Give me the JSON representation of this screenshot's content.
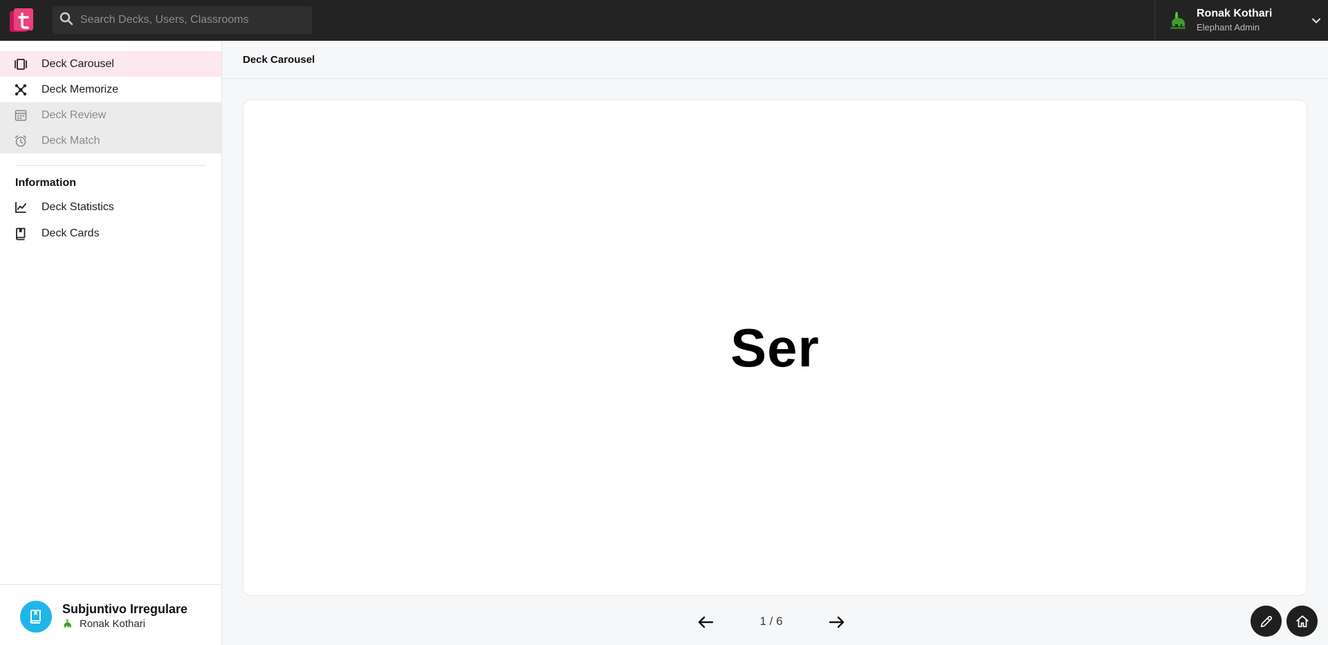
{
  "topbar": {
    "search_placeholder": "Search Decks, Users, Classrooms",
    "user": {
      "name": "Ronak Kothari",
      "role": "Elephant Admin"
    }
  },
  "sidebar": {
    "items": [
      {
        "label": "Deck Carousel",
        "icon": "carousel-icon",
        "state": "active"
      },
      {
        "label": "Deck Memorize",
        "icon": "memorize-icon",
        "state": "normal"
      },
      {
        "label": "Deck Review",
        "icon": "calendar-icon",
        "state": "disabled"
      },
      {
        "label": "Deck Match",
        "icon": "alarm-clock-icon",
        "state": "disabled"
      }
    ],
    "section_title": "Information",
    "info_items": [
      {
        "label": "Deck Statistics",
        "icon": "chart-line-icon"
      },
      {
        "label": "Deck Cards",
        "icon": "book-icon"
      }
    ],
    "deck": {
      "title": "Subjuntivo Irregulare",
      "owner": "Ronak Kothari"
    }
  },
  "main": {
    "header_title": "Deck Carousel",
    "card_text": "Ser",
    "pager": {
      "current": 1,
      "total": 6,
      "text": "1 / 6"
    }
  },
  "colors": {
    "topbar": "#232323",
    "active_nav": "#fde8ee",
    "disabled_nav": "#ebebeb",
    "deck_icon": "#1fb6e9",
    "logo_pink": "#e8408a"
  }
}
